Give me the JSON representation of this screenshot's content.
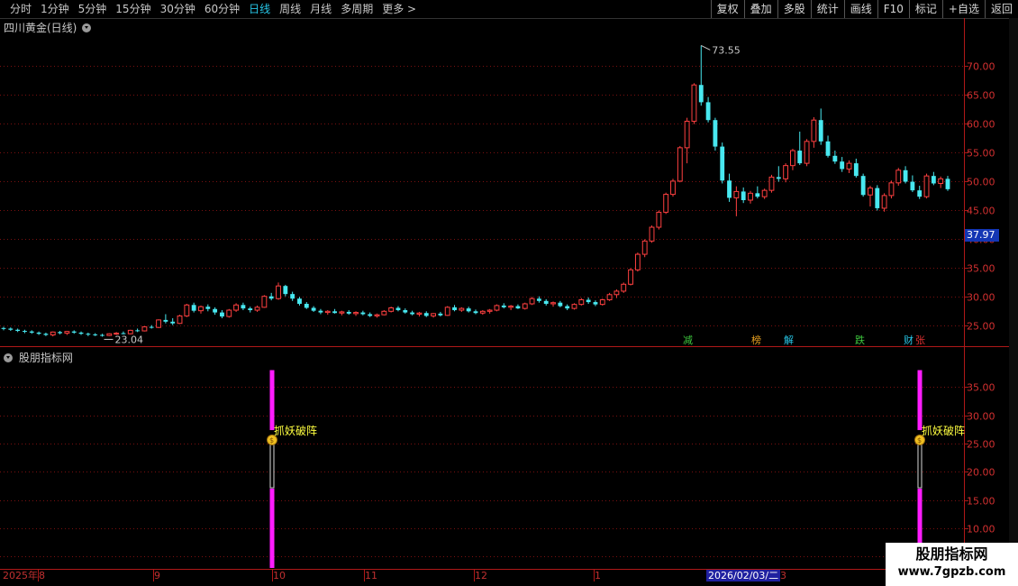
{
  "toolbar": {
    "periods": [
      "分时",
      "1分钟",
      "5分钟",
      "15分钟",
      "30分钟",
      "60分钟",
      "日线",
      "周线",
      "月线",
      "多周期",
      "更多 >"
    ],
    "active_period": "日线",
    "tools": [
      "复权",
      "叠加",
      "多股",
      "统计",
      "画线",
      "F10",
      "标记",
      "+自选",
      "返回"
    ]
  },
  "main_panel": {
    "title": "四川黄金(日线)",
    "current_price": "37.97",
    "high_label": "73.55",
    "low_label": "23.04",
    "events": [
      {
        "text": "减",
        "color": "#3ec83e"
      },
      {
        "text": "榜",
        "color": "#e8a020"
      },
      {
        "text": "解",
        "color": "#27c7e8"
      },
      {
        "text": "跌",
        "color": "#3ec83e"
      },
      {
        "text": "财",
        "color": "#27c7e8"
      },
      {
        "text": "张",
        "color": "#e03030"
      }
    ]
  },
  "indicator_panel": {
    "title": "股朋指标网",
    "signal_label": "抓妖破阵",
    "signal_color": "#ff1cff"
  },
  "date_axis": {
    "labels": [
      "2025年",
      "8",
      "9",
      "10",
      "11",
      "12",
      "1",
      "3"
    ],
    "cursor_date": "2026/02/03/二"
  },
  "watermark": {
    "name": "股朋指标网",
    "url": "www.7gpzb.com"
  },
  "colors": {
    "up": "#ff4040",
    "down": "#48e8f0",
    "grid": "#7a1010",
    "border": "#b01818"
  },
  "chart_data": [
    {
      "type": "candlestick",
      "title": "四川黄金(日线)",
      "y_ticks": [
        25.0,
        30.0,
        35.0,
        40.0,
        45.0,
        50.0,
        55.0,
        60.0,
        65.0,
        70.0
      ],
      "ylim": [
        21.5,
        75.5
      ],
      "x_months": [
        "2025年",
        "8",
        "9",
        "10",
        "11",
        "12",
        "1",
        "2",
        "3"
      ],
      "ohlc": [
        [
          24.5,
          24.7,
          24.1,
          24.4
        ],
        [
          24.4,
          24.6,
          24.0,
          24.2
        ],
        [
          24.2,
          24.4,
          23.8,
          24.0
        ],
        [
          24.0,
          24.2,
          23.6,
          23.9
        ],
        [
          23.9,
          24.1,
          23.5,
          23.7
        ],
        [
          23.7,
          23.9,
          23.3,
          23.5
        ],
        [
          23.5,
          23.7,
          23.1,
          23.3
        ],
        [
          23.3,
          23.9,
          23.04,
          23.8
        ],
        [
          23.8,
          24.0,
          23.4,
          23.6
        ],
        [
          23.6,
          24.0,
          23.3,
          23.9
        ],
        [
          23.9,
          24.1,
          23.5,
          23.7
        ],
        [
          23.7,
          23.9,
          23.3,
          23.5
        ],
        [
          23.5,
          23.7,
          23.1,
          23.4
        ],
        [
          23.4,
          23.6,
          23.1,
          23.3
        ],
        [
          23.3,
          23.5,
          23.0,
          23.2
        ],
        [
          23.2,
          23.6,
          23.1,
          23.5
        ],
        [
          23.5,
          23.8,
          23.3,
          23.6
        ],
        [
          23.6,
          23.9,
          23.4,
          23.5
        ],
        [
          23.5,
          24.2,
          23.4,
          24.1
        ],
        [
          24.1,
          24.4,
          23.8,
          24.0
        ],
        [
          24.0,
          24.8,
          23.9,
          24.7
        ],
        [
          24.7,
          25.0,
          24.4,
          24.6
        ],
        [
          24.6,
          26.0,
          24.5,
          25.9
        ],
        [
          25.9,
          26.9,
          25.3,
          25.6
        ],
        [
          25.6,
          26.2,
          25.0,
          25.3
        ],
        [
          25.3,
          26.8,
          25.2,
          26.6
        ],
        [
          26.6,
          28.7,
          26.4,
          28.5
        ],
        [
          28.5,
          28.9,
          27.2,
          27.5
        ],
        [
          27.5,
          28.4,
          27.0,
          28.2
        ],
        [
          28.2,
          28.6,
          27.4,
          27.8
        ],
        [
          27.8,
          28.1,
          26.8,
          27.2
        ],
        [
          27.2,
          27.6,
          26.2,
          26.5
        ],
        [
          26.5,
          27.8,
          26.3,
          27.6
        ],
        [
          27.6,
          28.8,
          27.3,
          28.5
        ],
        [
          28.5,
          28.9,
          27.6,
          27.9
        ],
        [
          27.9,
          28.2,
          27.2,
          27.6
        ],
        [
          27.6,
          28.4,
          27.3,
          28.1
        ],
        [
          28.1,
          30.2,
          28.0,
          30.0
        ],
        [
          30.0,
          30.6,
          29.3,
          29.6
        ],
        [
          29.6,
          32.4,
          29.4,
          31.8
        ],
        [
          31.8,
          32.0,
          30.0,
          30.4
        ],
        [
          30.4,
          30.8,
          29.2,
          29.6
        ],
        [
          29.6,
          29.9,
          28.4,
          28.7
        ],
        [
          28.7,
          29.0,
          27.8,
          28.0
        ],
        [
          28.0,
          28.3,
          27.3,
          27.5
        ],
        [
          27.5,
          27.8,
          26.9,
          27.2
        ],
        [
          27.2,
          27.6,
          26.8,
          27.4
        ],
        [
          27.4,
          27.8,
          27.0,
          27.1
        ],
        [
          27.1,
          27.5,
          26.7,
          27.3
        ],
        [
          27.3,
          27.6,
          26.8,
          27.0
        ],
        [
          27.0,
          27.4,
          26.6,
          27.2
        ],
        [
          27.2,
          27.5,
          26.7,
          26.9
        ],
        [
          26.9,
          27.2,
          26.4,
          26.6
        ],
        [
          26.6,
          27.0,
          26.3,
          26.8
        ],
        [
          26.8,
          27.6,
          26.7,
          27.4
        ],
        [
          27.4,
          28.2,
          27.2,
          28.0
        ],
        [
          28.0,
          28.3,
          27.4,
          27.6
        ],
        [
          27.6,
          27.9,
          27.0,
          27.2
        ],
        [
          27.2,
          27.5,
          26.7,
          26.9
        ],
        [
          26.9,
          27.3,
          26.5,
          27.1
        ],
        [
          27.1,
          27.4,
          26.4,
          26.6
        ],
        [
          26.6,
          27.1,
          26.3,
          27.0
        ],
        [
          27.0,
          27.3,
          26.5,
          26.7
        ],
        [
          26.7,
          28.3,
          26.6,
          28.1
        ],
        [
          28.1,
          28.5,
          27.4,
          27.6
        ],
        [
          27.6,
          28.1,
          27.3,
          27.9
        ],
        [
          27.9,
          28.2,
          27.2,
          27.4
        ],
        [
          27.4,
          27.7,
          26.9,
          27.1
        ],
        [
          27.1,
          27.6,
          26.8,
          27.4
        ],
        [
          27.4,
          27.8,
          27.0,
          27.6
        ],
        [
          27.6,
          28.6,
          27.4,
          28.4
        ],
        [
          28.4,
          28.8,
          27.9,
          28.1
        ],
        [
          28.1,
          28.5,
          27.6,
          28.3
        ],
        [
          28.3,
          28.6,
          27.8,
          27.9
        ],
        [
          27.9,
          28.9,
          27.7,
          28.7
        ],
        [
          28.7,
          29.9,
          28.5,
          29.6
        ],
        [
          29.6,
          30.0,
          28.9,
          29.2
        ],
        [
          29.2,
          29.5,
          28.4,
          28.7
        ],
        [
          28.7,
          29.1,
          28.2,
          28.9
        ],
        [
          28.9,
          29.2,
          28.1,
          28.3
        ],
        [
          28.3,
          28.6,
          27.6,
          27.9
        ],
        [
          27.9,
          28.8,
          27.7,
          28.6
        ],
        [
          28.6,
          29.7,
          28.4,
          29.4
        ],
        [
          29.4,
          29.8,
          28.7,
          29.0
        ],
        [
          29.0,
          29.3,
          28.3,
          28.6
        ],
        [
          28.6,
          29.6,
          28.4,
          29.4
        ],
        [
          29.4,
          30.6,
          29.2,
          30.3
        ],
        [
          30.3,
          31.2,
          29.7,
          30.9
        ],
        [
          30.9,
          32.4,
          30.6,
          32.1
        ],
        [
          32.1,
          34.9,
          31.9,
          34.6
        ],
        [
          34.6,
          37.6,
          34.3,
          37.3
        ],
        [
          37.3,
          39.9,
          36.8,
          39.6
        ],
        [
          39.6,
          42.3,
          39.3,
          42.0
        ],
        [
          42.0,
          44.9,
          41.6,
          44.6
        ],
        [
          44.6,
          48.0,
          44.3,
          47.7
        ],
        [
          47.7,
          50.4,
          47.3,
          50.0
        ],
        [
          50.0,
          56.1,
          49.8,
          55.8
        ],
        [
          55.8,
          61.0,
          53.1,
          60.4
        ],
        [
          60.4,
          67.0,
          59.9,
          66.7
        ],
        [
          66.7,
          73.55,
          63.1,
          63.7
        ],
        [
          63.7,
          64.6,
          60.2,
          60.6
        ],
        [
          60.6,
          61.0,
          55.3,
          56.0
        ],
        [
          56.0,
          56.7,
          49.6,
          50.1
        ],
        [
          50.1,
          51.3,
          46.4,
          47.1
        ],
        [
          47.1,
          49.1,
          43.9,
          48.2
        ],
        [
          48.2,
          48.9,
          46.2,
          46.7
        ],
        [
          46.7,
          48.3,
          46.1,
          47.9
        ],
        [
          47.9,
          49.1,
          47.0,
          47.3
        ],
        [
          47.3,
          48.7,
          46.9,
          48.4
        ],
        [
          48.4,
          51.1,
          48.0,
          50.7
        ],
        [
          50.7,
          52.6,
          49.9,
          50.4
        ],
        [
          50.4,
          53.1,
          49.8,
          52.7
        ],
        [
          52.7,
          55.6,
          51.9,
          55.3
        ],
        [
          55.3,
          58.6,
          52.8,
          53.1
        ],
        [
          53.1,
          57.3,
          52.6,
          56.9
        ],
        [
          56.9,
          61.1,
          55.8,
          60.6
        ],
        [
          60.6,
          62.6,
          56.3,
          56.9
        ],
        [
          56.9,
          57.9,
          54.1,
          54.4
        ],
        [
          54.4,
          55.3,
          53.0,
          53.4
        ],
        [
          53.4,
          54.2,
          51.6,
          52.1
        ],
        [
          52.1,
          53.6,
          51.4,
          53.1
        ],
        [
          53.1,
          53.9,
          50.6,
          50.9
        ],
        [
          50.9,
          51.3,
          47.3,
          47.6
        ],
        [
          47.6,
          49.2,
          45.6,
          48.8
        ],
        [
          48.8,
          49.3,
          44.9,
          45.3
        ],
        [
          45.3,
          47.9,
          44.7,
          47.5
        ],
        [
          47.5,
          50.1,
          47.0,
          49.7
        ],
        [
          49.7,
          52.3,
          49.2,
          51.9
        ],
        [
          51.9,
          52.6,
          49.6,
          49.9
        ],
        [
          49.9,
          51.0,
          48.1,
          48.4
        ],
        [
          48.4,
          49.2,
          46.9,
          47.3
        ],
        [
          47.3,
          51.3,
          47.0,
          50.9
        ],
        [
          50.9,
          51.6,
          49.3,
          49.6
        ],
        [
          49.6,
          50.8,
          48.8,
          50.4
        ],
        [
          50.4,
          50.9,
          48.3,
          48.6
        ]
      ]
    },
    {
      "type": "bar",
      "title": "股朋指标网",
      "y_ticks": [
        5.0,
        10.0,
        15.0,
        20.0,
        25.0,
        30.0,
        35.0
      ],
      "ylim": [
        3.0,
        40.0
      ],
      "series": [
        {
          "name": "抓妖破阵",
          "signal_indices": [
            0,
            1
          ],
          "values": [
            38,
            38
          ],
          "threshold": 25
        }
      ]
    }
  ]
}
